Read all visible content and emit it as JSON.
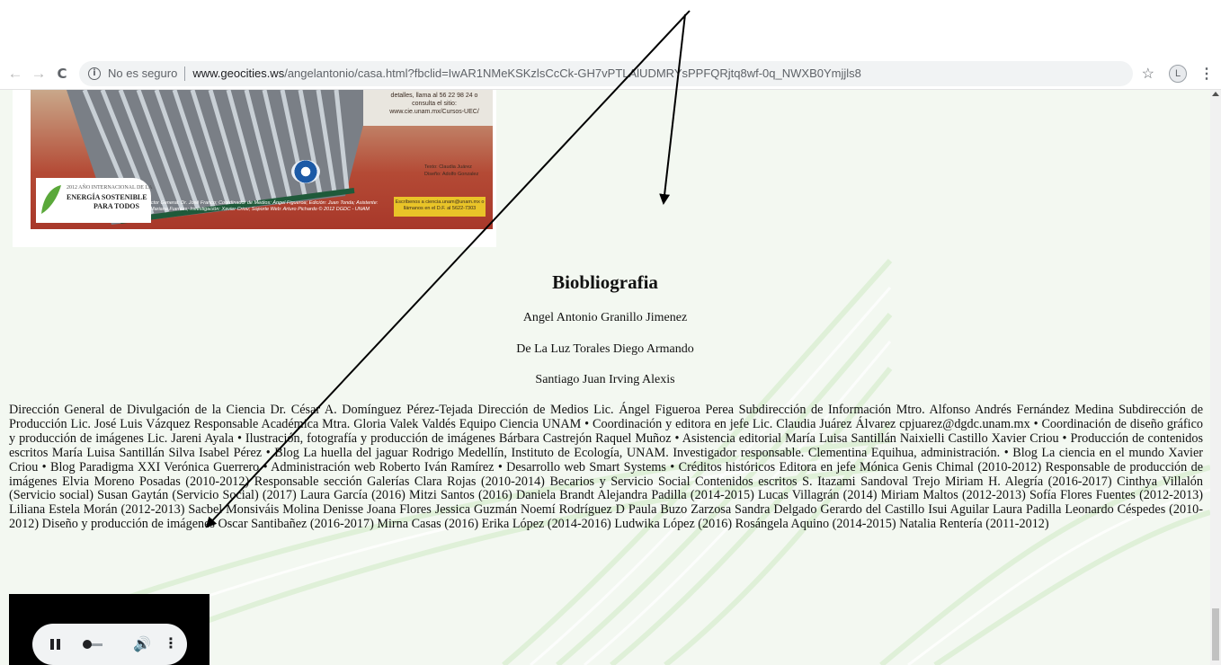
{
  "browser": {
    "back_icon": "←",
    "forward_icon": "→",
    "reload_icon": "C",
    "security_label": "No es seguro",
    "url_host": "www.geocities.ws",
    "url_path": "/angelantonio/casa.html?fbclid=IwAR1NMeKSKzlsCcCk-GH7vPTLAlUDMRYsPPFQRjtq8wf-0q_NWXB0Ymjjls8",
    "star_icon": "☆",
    "profile_initial": "L",
    "menu_icon": "⋮"
  },
  "poster": {
    "contact_text": "detalles, llama al 56 22 98 24 o consulta el sitio: www.cie.unam.mx/Cursos-UEC/",
    "year_line1": "2012 AÑO INTERNACIONAL DE LA",
    "year_line2": "ENERGÍA SOSTENIBLE",
    "year_line3": "PARA TODOS",
    "credits_small": "Texto: Claudia Juárez\nDiseño: Adolfo Gonzalez",
    "credit_line": "Director General: Dr. José Franco; Coordinador de Medios: Ángel Figueroa; Edición: Juan Tonda; Asistente: Mariana Fuentes; Investigación: Xavier Criou; Soporte Web: Arturo Pichardo © 2012 DGDC - UNAM",
    "email_box": "Escríbenos a ciencia.unam@unam.mx o llámanos en el D.F. al 5622-7303"
  },
  "content": {
    "title": "Biobliografia",
    "authors": [
      "Angel Antonio Granillo Jimenez",
      "De La Luz Torales Diego Armando",
      "Santiago Juan Irving Alexis"
    ],
    "credits_text": "Dirección General de Divulgación de la Ciencia Dr. César A. Domínguez Pérez-Tejada Dirección de Medios Lic. Ángel Figueroa Perea Subdirección de Información Mtro. Alfonso Andrés Fernández Medina Subdirección de Producción Lic. José Luis Vázquez Responsable Académica Mtra. Gloria Valek Valdés Equipo Ciencia UNAM • Coordinación y editora en jefe Lic. Claudia Juárez Álvarez cpjuarez@dgdc.unam.mx • Coordinación de diseño gráfico y producción de imágenes Lic. Jareni Ayala • Ilustración, fotografía y producción de imágenes Bárbara Castrejón Raquel Muñoz • Asistencia editorial María Luisa Santillán Naixielli Castillo Xavier Criou • Producción de contenidos escritos María Luisa Santillán Silva Isabel Pérez • Blog La huella del jaguar Rodrigo Medellín, Instituto de Ecología, UNAM. Investigador responsable. Clementina Equihua, administración. • Blog La ciencia en el mundo Xavier Criou • Blog Paradigma XXI Verónica Guerrero • Administración web Roberto Iván Ramírez • Desarrollo web Smart Systems • Créditos históricos Editora en jefe Mónica Genis Chimal (2010-2012) Responsable de producción de imágenes Elvia Moreno Posadas (2010-2012) Responsable sección Galerías Clara Rojas (2010-2014) Becarios y Servicio Social Contenidos escritos S. Itazami Sandoval Trejo Miriam H. Alegría (2016-2017) Cinthya Villalón (Servicio social) Susan Gaytán (Servicio Social) (2017) Laura García (2016) Mitzi Santos (2016) Daniela Brandt Alejandra Padilla (2014-2015) Lucas Villagrán (2014) Miriam Maltos (2012-2013) Sofía Flores Fuentes (2012-2013) Liliana Estela Morán (2012-2013) Sacbel Monsiváis Molina Denisse Joana Flores Jessica Guzmán Noemí Rodríguez D Paula Buzo Zarzosa Sandra Delgado Gerardo del Castillo Isui Aguilar Laura Padilla Leonardo Céspedes (2010-2012) Diseño y producción de imágenes Oscar Santibañez (2016-2017) Mirna Casas (2016) Erika López (2014-2016) Ludwika López (2016) Rosángela Aquino (2014-2015) Natalia Rentería (2011-2012)"
  },
  "player": {
    "pause_icon": "pause-icon",
    "volume_icon": "🔊",
    "more_icon": "⋮"
  },
  "colors": {
    "page_bg": "#f4f8f2",
    "swirl": "#dcefd6",
    "arrow": "#000000"
  }
}
